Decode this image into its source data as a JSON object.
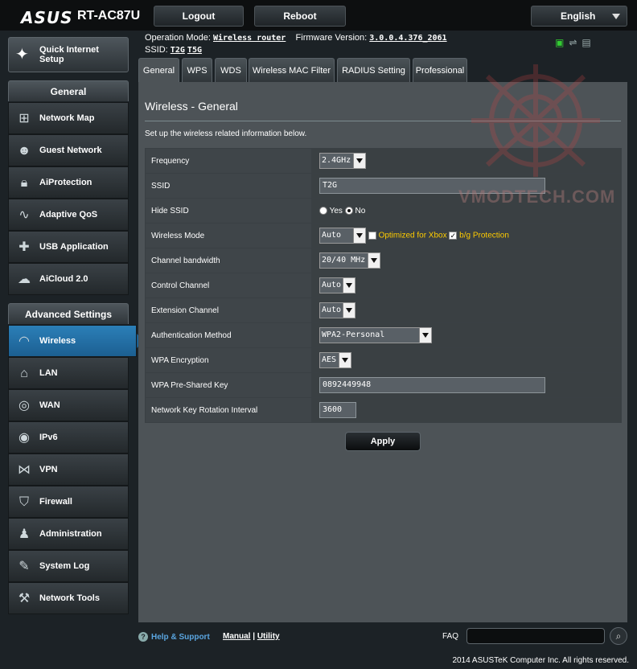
{
  "header": {
    "brand": "ASUS",
    "model": "RT-AC87U",
    "logout_label": "Logout",
    "reboot_label": "Reboot",
    "language": "English"
  },
  "status": {
    "op_mode_label": "Operation Mode:",
    "op_mode_value": "Wireless router",
    "fw_label": "Firmware Version:",
    "fw_value": "3.0.0.4.376_2061",
    "ssid_label": "SSID:",
    "ssid_1": "T2G",
    "ssid_2": "T5G"
  },
  "sidebar": {
    "qis_label_1": "Quick Internet",
    "qis_label_2": "Setup",
    "general_head": "General",
    "general_items": [
      {
        "label": "Network Map",
        "icon": "network-map-icon"
      },
      {
        "label": "Guest Network",
        "icon": "guest-network-icon"
      },
      {
        "label": "AiProtection",
        "icon": "lock-icon"
      },
      {
        "label": "Adaptive QoS",
        "icon": "qos-icon"
      },
      {
        "label": "USB Application",
        "icon": "puzzle-icon"
      },
      {
        "label": "AiCloud 2.0",
        "icon": "cloud-icon"
      }
    ],
    "advanced_head": "Advanced Settings",
    "advanced_items": [
      {
        "label": "Wireless",
        "icon": "wifi-icon"
      },
      {
        "label": "LAN",
        "icon": "home-icon"
      },
      {
        "label": "WAN",
        "icon": "globe-icon"
      },
      {
        "label": "IPv6",
        "icon": "ipv6-icon"
      },
      {
        "label": "VPN",
        "icon": "vpn-icon"
      },
      {
        "label": "Firewall",
        "icon": "shield-icon"
      },
      {
        "label": "Administration",
        "icon": "admin-icon"
      },
      {
        "label": "System Log",
        "icon": "log-icon"
      },
      {
        "label": "Network Tools",
        "icon": "tools-icon"
      }
    ]
  },
  "tabs": [
    "General",
    "WPS",
    "WDS",
    "Wireless MAC Filter",
    "RADIUS Setting",
    "Professional"
  ],
  "panel": {
    "title_main": "Wireless",
    "title_sub": " - General",
    "description": "Set up the wireless related information below."
  },
  "form": {
    "frequency_label": "Frequency",
    "frequency_value": "2.4GHz",
    "ssid_label": "SSID",
    "ssid_value": "T2G",
    "hide_ssid_label": "Hide SSID",
    "hide_yes": "Yes",
    "hide_no": "No",
    "mode_label": "Wireless Mode",
    "mode_value": "Auto",
    "xbox_label": "Optimized for Xbox",
    "bg_label": "b/g Protection",
    "bw_label": "Channel bandwidth",
    "bw_value": "20/40 MHz",
    "ctrl_label": "Control Channel",
    "ctrl_value": "Auto",
    "ext_label": "Extension Channel",
    "ext_value": "Auto",
    "auth_label": "Authentication Method",
    "auth_value": "WPA2-Personal",
    "enc_label": "WPA Encryption",
    "enc_value": "AES",
    "psk_label": "WPA Pre-Shared Key",
    "psk_value": "0892449948",
    "rot_label": "Network Key Rotation Interval",
    "rot_value": "3600",
    "apply_label": "Apply"
  },
  "footer": {
    "help_label": "Help & Support",
    "manual": "Manual",
    "sep": " | ",
    "utility": "Utility",
    "faq": "FAQ",
    "copyright": "2014 ASUSTeK Computer Inc. All rights reserved."
  },
  "watermark": "VMODTECH.COM"
}
